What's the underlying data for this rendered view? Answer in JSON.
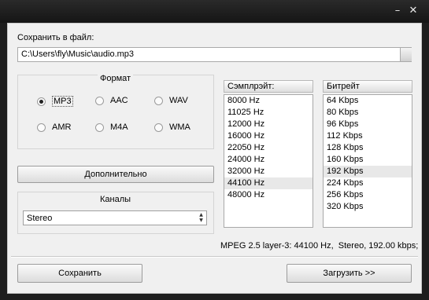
{
  "window": {
    "close_glyph": "✕",
    "minimize_glyph": "–"
  },
  "save_to_file_label": "Сохранить в файл:",
  "path_value": "C:\\Users\\fly\\Music\\audio.mp3",
  "format": {
    "title": "Формат",
    "options": [
      "MP3",
      "AAC",
      "WAV",
      "AMR",
      "M4A",
      "WMA"
    ],
    "selected": "MP3"
  },
  "advanced_button": "Дополнительно",
  "channels": {
    "title": "Каналы",
    "value": "Stereo"
  },
  "samplerate": {
    "header": "Сэмплрэйт:",
    "items": [
      "8000 Hz",
      "11025 Hz",
      "12000 Hz",
      "16000 Hz",
      "22050 Hz",
      "24000 Hz",
      "32000 Hz",
      "44100 Hz",
      "48000 Hz"
    ],
    "selected": "44100 Hz"
  },
  "bitrate": {
    "header": "Битрейт",
    "items": [
      "64 Kbps",
      "80 Kbps",
      "96 Kbps",
      "112 Kbps",
      "128 Kbps",
      "160 Kbps",
      "192 Kbps",
      "224 Kbps",
      "256 Kbps",
      "320 Kbps"
    ],
    "selected": "192 Kbps"
  },
  "status_text": "MPEG 2.5 layer-3: 44100 Hz,  Stereo, 192.00 kbps;",
  "save_button": "Сохранить",
  "load_button": "Загрузить >>"
}
